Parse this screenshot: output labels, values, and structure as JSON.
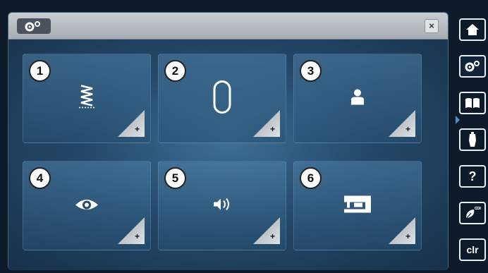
{
  "window": {
    "close_label": "×"
  },
  "tiles": [
    {
      "number": "1",
      "icon": "stitch-zigzag-icon",
      "action_label": "+"
    },
    {
      "number": "2",
      "icon": "hoop-icon",
      "action_label": "+"
    },
    {
      "number": "3",
      "icon": "user-icon",
      "action_label": "+"
    },
    {
      "number": "4",
      "icon": "eye-icon",
      "action_label": "+"
    },
    {
      "number": "5",
      "icon": "speaker-icon",
      "action_label": "+"
    },
    {
      "number": "6",
      "icon": "sewing-machine-icon",
      "action_label": "+"
    }
  ],
  "sidebar": {
    "items": [
      {
        "icon": "home-icon"
      },
      {
        "icon": "settings-icon"
      },
      {
        "icon": "book-icon"
      },
      {
        "icon": "sewing-consultant-icon"
      },
      {
        "label": "?",
        "icon": "help-icon"
      },
      {
        "icon": "eco-icon"
      },
      {
        "label": "clr",
        "icon": "clear-icon"
      }
    ]
  },
  "colors": {
    "background": "#0e1a29",
    "content_glow": "#3e6f93",
    "tile": "#3d6a90",
    "titlebar": "#b8bec4",
    "accent": "#4a90c8"
  }
}
